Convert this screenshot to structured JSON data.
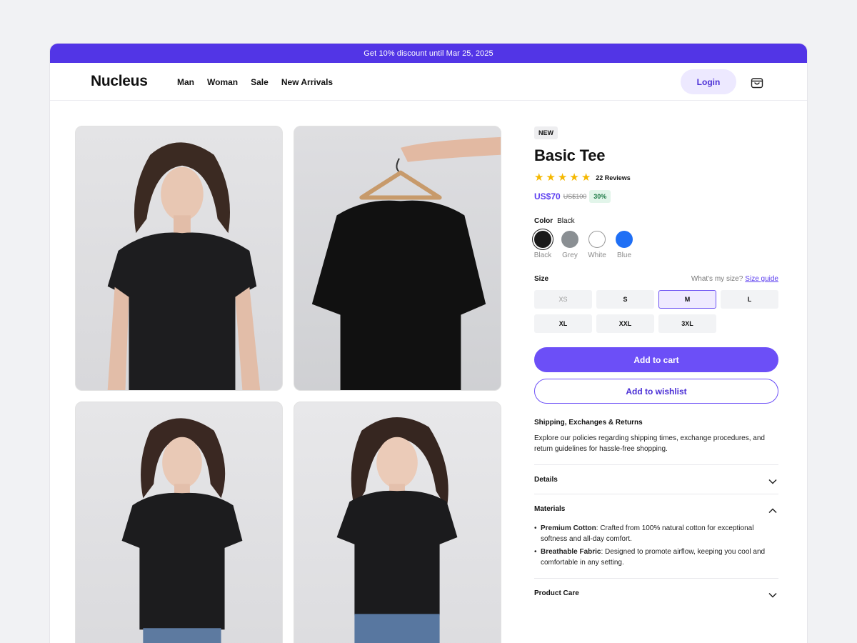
{
  "promo": {
    "text": "Get 10% discount until Mar 25, 2025"
  },
  "header": {
    "logo": "Nucleus",
    "menu": [
      "Man",
      "Woman",
      "Sale",
      "New Arrivals"
    ],
    "login_label": "Login",
    "cart_icon": "shopping-bag-icon"
  },
  "product": {
    "badge": "NEW",
    "title": "Basic Tee",
    "rating": 5,
    "reviews": "22 Reviews",
    "price": "US$70",
    "old_price": "US$100",
    "discount": "30%",
    "color": {
      "label": "Color",
      "selected": "Black",
      "options": [
        {
          "name": "Black",
          "hex": "#1a1a1a"
        },
        {
          "name": "Grey",
          "hex": "#8a8f93"
        },
        {
          "name": "White",
          "hex": "#ffffff"
        },
        {
          "name": "Blue",
          "hex": "#1f6ff5"
        }
      ]
    },
    "size": {
      "label": "Size",
      "help": "What's my size?",
      "guide": "Size guide",
      "selected": "M",
      "options": [
        "XS",
        "S",
        "M",
        "L",
        "XL",
        "XXL",
        "3XL"
      ]
    },
    "add_to_cart": "Add to cart",
    "add_to_wishlist": "Add to wishlist",
    "shipping": {
      "title": "Shipping, Exchanges & Returns",
      "body": "Explore our policies regarding shipping times, exchange procedures, and return guidelines for hassle-free shopping."
    },
    "accordion": {
      "details": "Details",
      "materials": "Materials",
      "materials_items": [
        {
          "term": "Premium Cotton",
          "text": ": Crafted from 100% natural cotton for exceptional softness and all-day comfort."
        },
        {
          "term": "Breathable Fabric",
          "text": ": Designed to promote airflow, keeping you cool and comfortable in any setting."
        }
      ],
      "care": "Product Care"
    }
  },
  "colors": {
    "accent": "#5b3df0",
    "promo_bg": "#5235e6",
    "discount_bg": "#e2f5ea"
  }
}
